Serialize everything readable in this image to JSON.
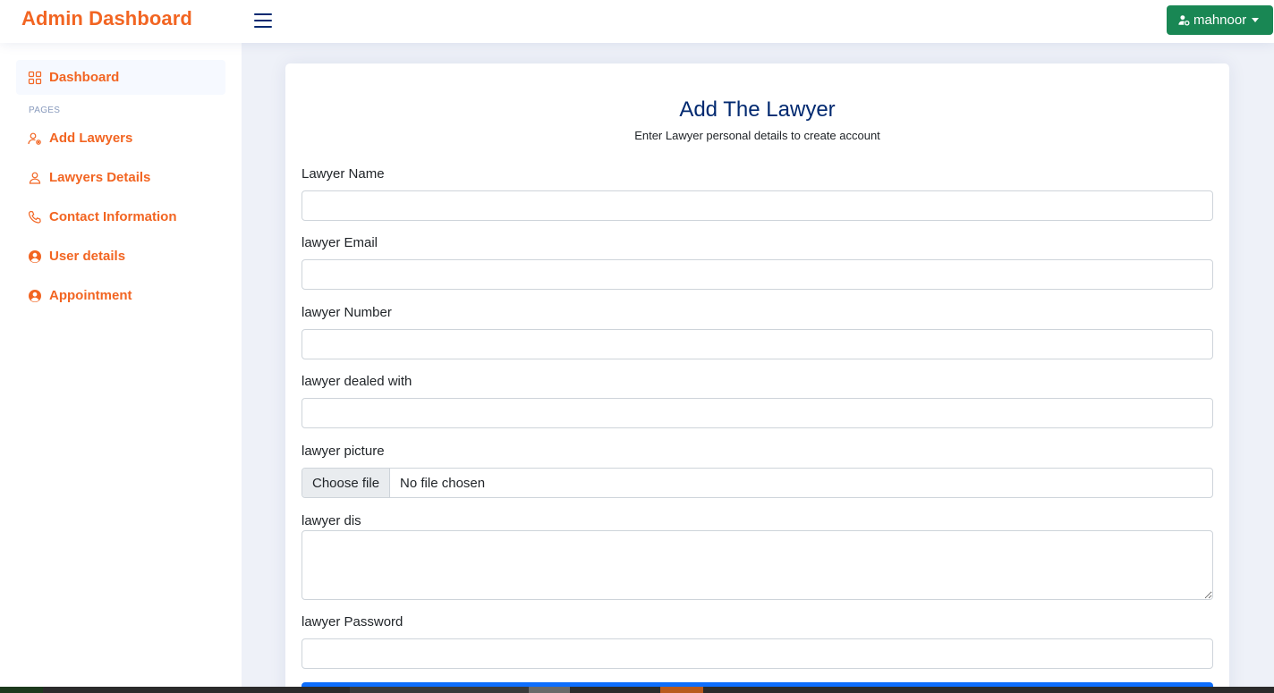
{
  "header": {
    "brand": "Admin Dashboard",
    "user_label": "mahnoor"
  },
  "sidebar": {
    "dashboard": "Dashboard",
    "heading": "PAGES",
    "items": [
      {
        "label": "Add Lawyers",
        "icon": "person-gear-icon"
      },
      {
        "label": "Lawyers Details",
        "icon": "person-icon"
      },
      {
        "label": "Contact Information",
        "icon": "telephone-icon"
      },
      {
        "label": "User details",
        "icon": "person-circle-icon"
      },
      {
        "label": "Appointment",
        "icon": "person-circle-icon"
      }
    ]
  },
  "form": {
    "title": "Add The Lawyer",
    "subtitle": "Enter Lawyer personal details to create account",
    "name_label": "Lawyer Name",
    "email_label": "lawyer Email",
    "number_label": "lawyer Number",
    "dealed_label": "lawyer dealed with",
    "picture_label": "lawyer picture",
    "choose_file": "Choose file",
    "no_file": "No file chosen",
    "dis_label": "lawyer dis",
    "password_label": "lawyer Password"
  },
  "colors": {
    "accent": "#f26522",
    "navy": "#012970",
    "user_button": "#198754",
    "submit": "#0d6efd"
  }
}
